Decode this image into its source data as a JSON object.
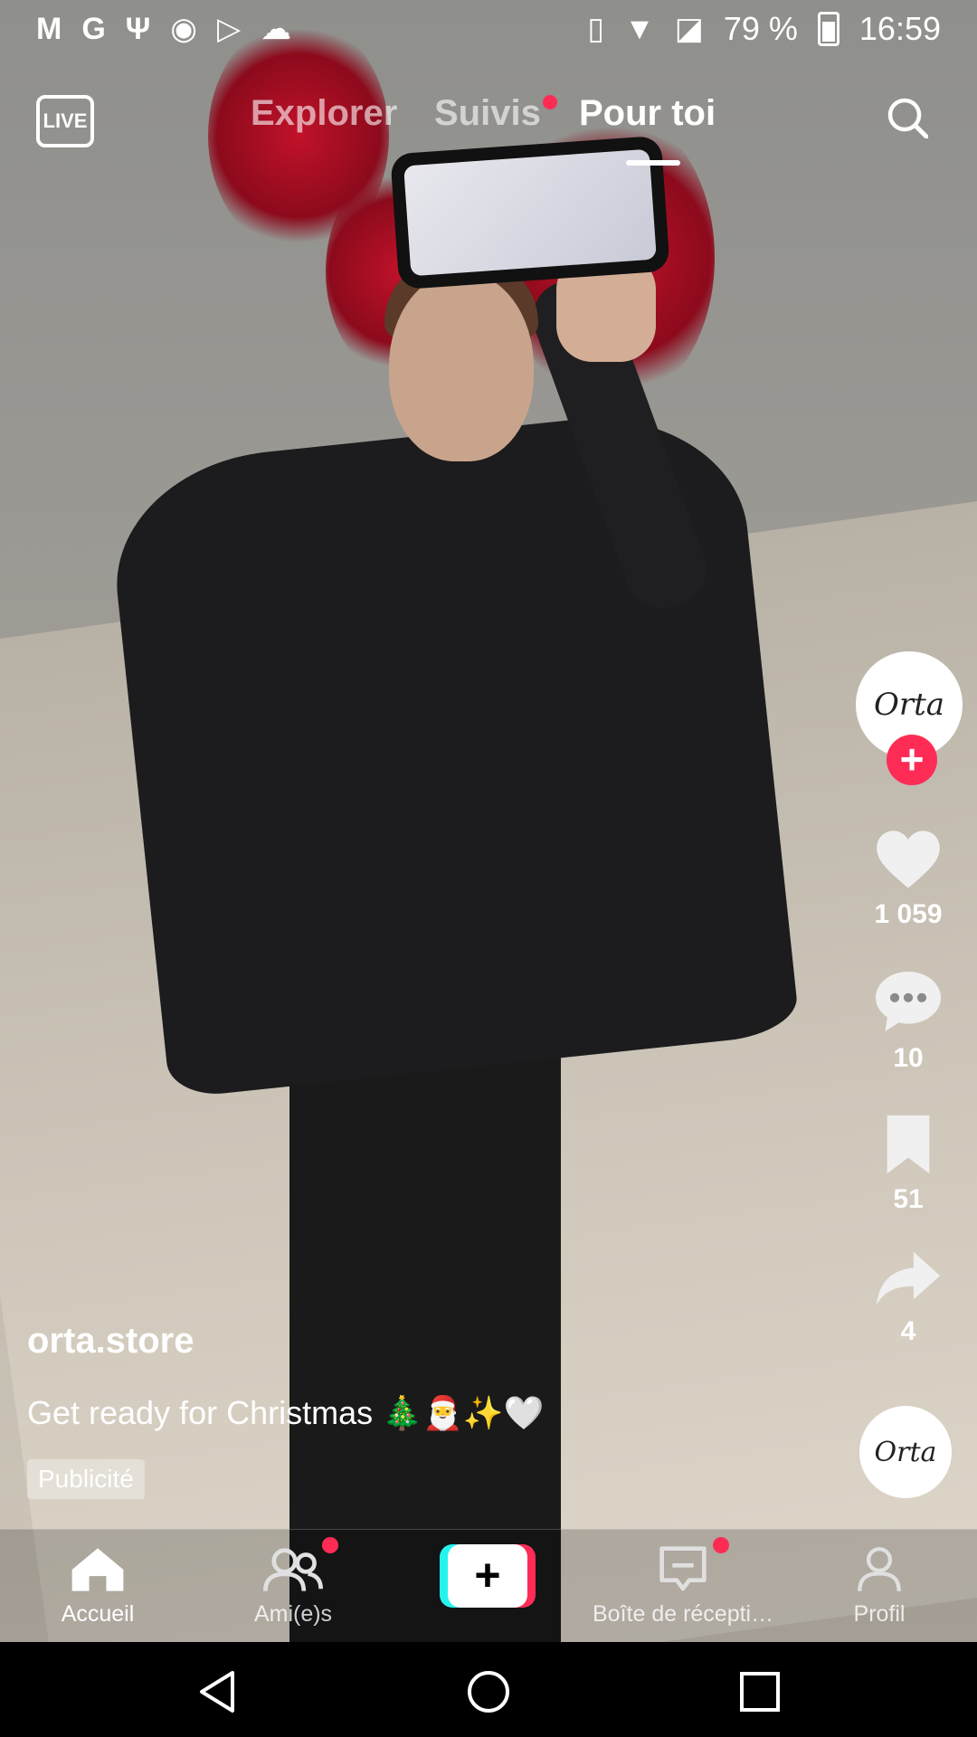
{
  "statusbar": {
    "left_icons": [
      "gmail-icon",
      "google-icon",
      "usb-icon",
      "app-icon",
      "play-icon",
      "cloud-icon"
    ],
    "battery_text": "79 %",
    "time": "16:59"
  },
  "topnav": {
    "live_label": "LIVE",
    "tabs": [
      {
        "label": "Explorer",
        "active": false
      },
      {
        "label": "Suivis",
        "active": false
      },
      {
        "label": "Pour toi",
        "active": true
      }
    ]
  },
  "rail": {
    "avatar_text": "Orta",
    "likes": "1 059",
    "comments": "10",
    "saves": "51",
    "shares": "4"
  },
  "post": {
    "username": "orta.store",
    "description": "Get ready for Christmas 🎄🎅✨🤍",
    "ad_label": "Publicité",
    "disc_text": "Orta"
  },
  "bottomnav": {
    "items": [
      {
        "label": "Accueil",
        "active": true
      },
      {
        "label": "Ami(e)s",
        "active": false
      },
      {
        "label": "Boîte de récepti…",
        "active": false
      },
      {
        "label": "Profil",
        "active": false
      }
    ]
  },
  "colors": {
    "accent": "#fe2c55",
    "cyan": "#25f4ee"
  }
}
